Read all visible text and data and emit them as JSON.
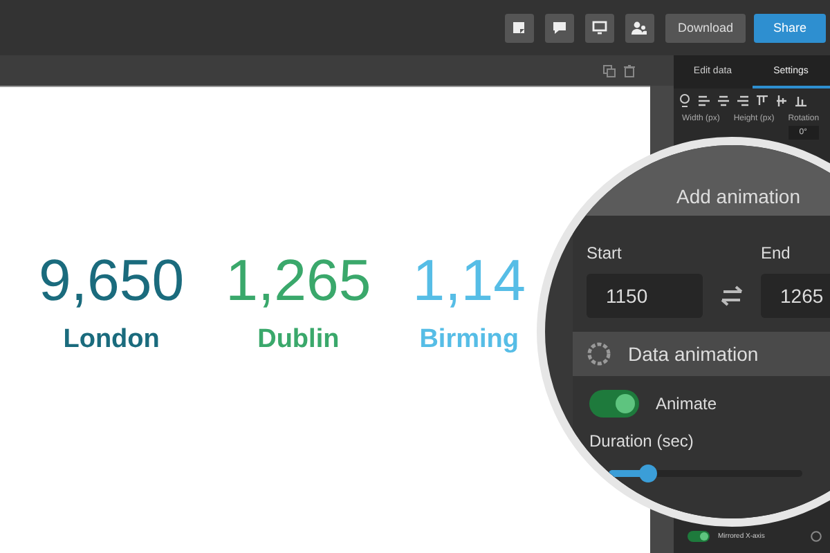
{
  "toolbar": {
    "icon_buttons": [
      {
        "kind": "note"
      },
      {
        "kind": "comment"
      },
      {
        "kind": "monitor"
      },
      {
        "kind": "users"
      }
    ],
    "buttons": [
      {
        "label": "Download",
        "kind": "secondary"
      },
      {
        "label": "Share",
        "kind": "primary"
      }
    ]
  },
  "canvas": {
    "stats": [
      {
        "value": "9,650",
        "label": "London",
        "color": "#1a6b7d"
      },
      {
        "value": "1,265",
        "label": "Dublin",
        "color": "#3aa86b"
      },
      {
        "value": "1,14",
        "label": "Birming",
        "color": "#56bde6"
      }
    ]
  },
  "panel": {
    "tabs": [
      {
        "label": "Edit data",
        "selected": false
      },
      {
        "label": "Settings",
        "selected": true
      }
    ],
    "fields": [
      {
        "label": "Width (px)"
      },
      {
        "label": "Height (px)"
      },
      {
        "label": "Rotation",
        "value": "0°"
      }
    ],
    "mirrored": {
      "label": "Mirrored X-axis",
      "on": true
    }
  },
  "magnifier": {
    "title": "Add animation",
    "start_label": "Start",
    "start_value": "1150",
    "end_label": "End",
    "end_value": "1265",
    "section": "Data animation",
    "animate": {
      "label": "Animate",
      "on": true
    },
    "duration_label": "Duration (sec)",
    "duration": {
      "level": 0.2
    }
  }
}
